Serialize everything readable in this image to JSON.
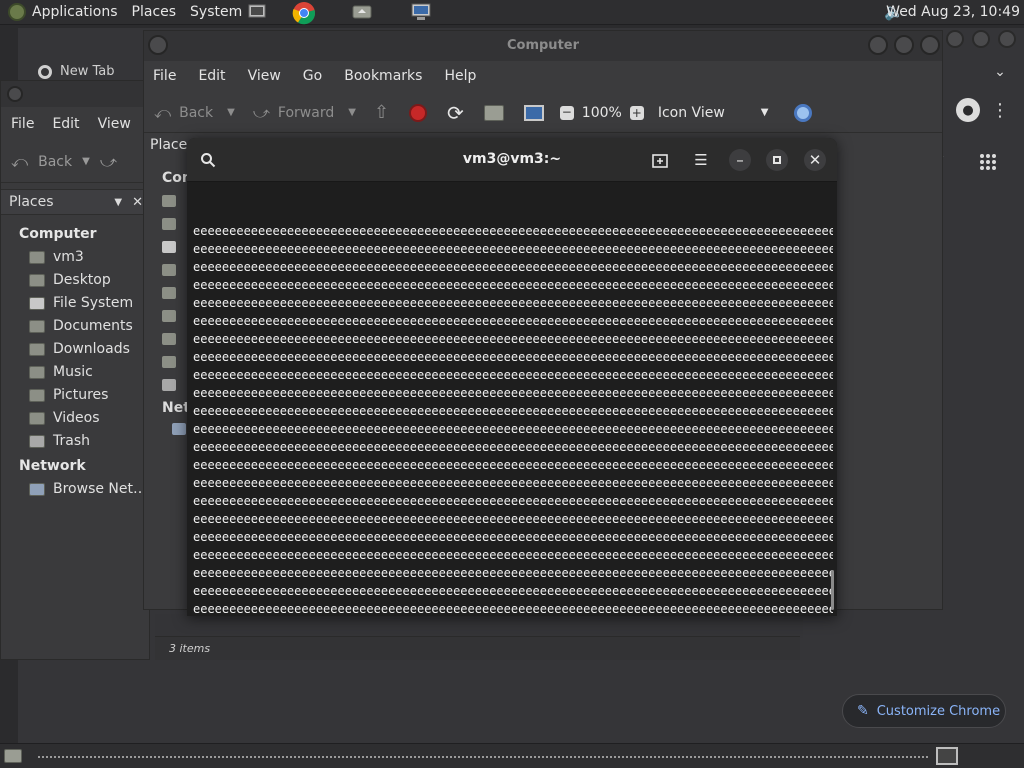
{
  "top_panel": {
    "menus": [
      "Applications",
      "Places",
      "System"
    ],
    "clock": "Wed Aug 23, 10:49"
  },
  "chrome": {
    "tab_title": "New Tab",
    "customize_label": "Customize Chrome"
  },
  "file_manager_back": {
    "menus": [
      "File",
      "Edit",
      "View"
    ],
    "toolbar": {
      "back": "Back"
    },
    "places_label": "Places",
    "sidebar": {
      "computer_header": "Computer",
      "computer_items": [
        "vm3",
        "Desktop",
        "File System",
        "Documents",
        "Downloads",
        "Music",
        "Pictures",
        "Videos",
        "Trash"
      ],
      "network_header": "Network",
      "network_items": [
        "Browse Net…"
      ]
    }
  },
  "file_manager_main": {
    "title": "Computer",
    "menus": [
      "File",
      "Edit",
      "View",
      "Go",
      "Bookmarks",
      "Help"
    ],
    "toolbar": {
      "back": "Back",
      "forward": "Forward",
      "zoom": "100%",
      "view_mode": "Icon View"
    },
    "places_label": "Places",
    "section_computer": "Com",
    "section_network": "Netw",
    "status": "3 items"
  },
  "terminal": {
    "title": "vm3@vm3:~",
    "full_line": "eeeeeeeeeeeeeeeeeeeeeeeeeeeeeeeeeeeeeeeeeeeeeeeeeeeeeeeeeeeeeeeeeeeeeeeeeeeeeeeeeeeeeeeeee",
    "full_line_count": 23,
    "last_line": "eeeeeeeeeeeeeeeeeeeeeeeeeeeeeeeeeeeeeeeeeeeeeeeeeeeeeeeeeeeeeeeeeeeeeeeeeeeeeeeeeeeeeeeeee"
  }
}
